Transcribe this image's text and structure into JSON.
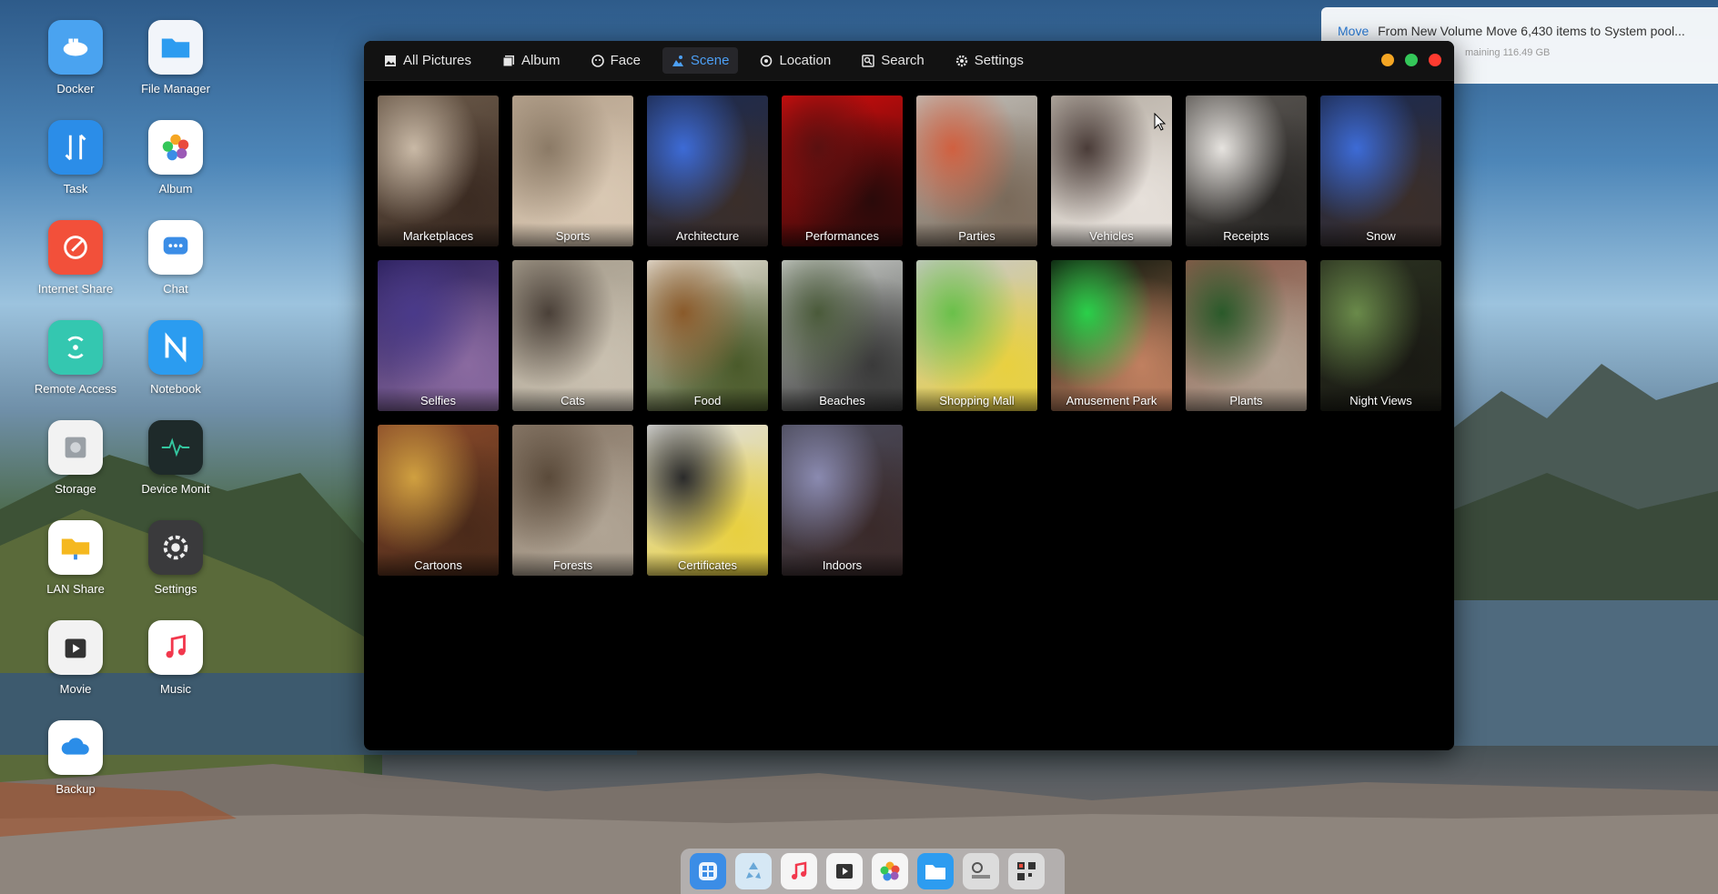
{
  "desktop_icons": [
    {
      "label": "Docker",
      "icon": "docker-icon"
    },
    {
      "label": "File Manager",
      "icon": "folder-icon"
    },
    {
      "label": "Task",
      "icon": "task-icon"
    },
    {
      "label": "Album",
      "icon": "album-icon"
    },
    {
      "label": "Internet Share",
      "icon": "share-icon"
    },
    {
      "label": "Chat",
      "icon": "chat-icon"
    },
    {
      "label": "Remote Access",
      "icon": "remote-access-icon"
    },
    {
      "label": "Notebook",
      "icon": "notebook-icon"
    },
    {
      "label": "Storage",
      "icon": "storage-icon"
    },
    {
      "label": "Device Monit",
      "icon": "device-monitor-icon"
    },
    {
      "label": "LAN Share",
      "icon": "lan-share-icon"
    },
    {
      "label": "Settings",
      "icon": "gear-icon"
    },
    {
      "label": "Movie",
      "icon": "movie-icon"
    },
    {
      "label": "Music",
      "icon": "music-icon"
    },
    {
      "label": "Backup",
      "icon": "backup-icon"
    }
  ],
  "notification": {
    "action": "Move",
    "text": "From New Volume Move 6,430 items to System pool...",
    "sub": "maining 116.49 GB"
  },
  "toolbar": {
    "tabs": [
      {
        "label": "All Pictures",
        "icon": "image-icon"
      },
      {
        "label": "Album",
        "icon": "album-icon"
      },
      {
        "label": "Face",
        "icon": "face-icon"
      },
      {
        "label": "Scene",
        "icon": "scene-icon",
        "active": true
      },
      {
        "label": "Location",
        "icon": "location-icon"
      },
      {
        "label": "Search",
        "icon": "search-icon"
      },
      {
        "label": "Settings",
        "icon": "gear-icon"
      }
    ]
  },
  "window_controls": {
    "minimize": "#f5a623",
    "maximize": "#34c759",
    "close": "#ff3b30"
  },
  "scenes": [
    {
      "label": "Marketplaces",
      "colors": [
        "#6b5a4a",
        "#c9b9a6",
        "#3b2b22"
      ]
    },
    {
      "label": "Sports",
      "colors": [
        "#b7a48f",
        "#8b7a66",
        "#d9c8b3"
      ]
    },
    {
      "label": "Architecture",
      "colors": [
        "#1c2a4f",
        "#3d6bd6",
        "#3a2e2a"
      ]
    },
    {
      "label": "Performances",
      "colors": [
        "#d40d0d",
        "#5a1010",
        "#2a0a0a"
      ]
    },
    {
      "label": "Parties",
      "colors": [
        "#c1beb8",
        "#d06040",
        "#7a6a5a"
      ]
    },
    {
      "label": "Vehicles",
      "colors": [
        "#b8b0a6",
        "#4a3c38",
        "#e6e0da"
      ]
    },
    {
      "label": "Receipts",
      "colors": [
        "#5a5652",
        "#e6e3df",
        "#2a2826"
      ]
    },
    {
      "label": "Snow",
      "colors": [
        "#1c2a4f",
        "#3d6bd6",
        "#3a2e2a"
      ]
    },
    {
      "label": "Selfies",
      "colors": [
        "#2a1f5a",
        "#4a3a8a",
        "#8a6aa0"
      ]
    },
    {
      "label": "Cats",
      "colors": [
        "#a79e8e",
        "#4a4038",
        "#c9c0b0"
      ]
    },
    {
      "label": "Food",
      "colors": [
        "#e8e2d8",
        "#8a5a2a",
        "#4a5a2a"
      ]
    },
    {
      "label": "Beaches",
      "colors": [
        "#c9ccc8",
        "#4a5a3a",
        "#3a3a3a"
      ]
    },
    {
      "label": "Shopping Mall",
      "colors": [
        "#c9c9c9",
        "#6ac04a",
        "#e8d040"
      ]
    },
    {
      "label": "Amusement Park",
      "colors": [
        "#0a140a",
        "#2ad04a",
        "#c08060"
      ]
    },
    {
      "label": "Plants",
      "colors": [
        "#8a5a4a",
        "#2a5a2a",
        "#b0a090"
      ]
    },
    {
      "label": "Night Views",
      "colors": [
        "#2a3020",
        "#6a8a4a",
        "#1a1a14"
      ]
    },
    {
      "label": "Cartoons",
      "colors": [
        "#8a4a2a",
        "#d0a040",
        "#4a2a1a"
      ]
    },
    {
      "label": "Forests",
      "colors": [
        "#8a7a6a",
        "#5a4a3a",
        "#b0a494"
      ]
    },
    {
      "label": "Certificates",
      "colors": [
        "#e0e0e0",
        "#2a2a2a",
        "#e8d040"
      ]
    },
    {
      "label": "Indoors",
      "colors": [
        "#4a4a5a",
        "#8a8ab0",
        "#3a2a2a"
      ]
    }
  ],
  "dock": [
    {
      "icon": "finder-icon",
      "color": "#3b8de6"
    },
    {
      "icon": "recycle-icon",
      "color": "#d6e8f5"
    },
    {
      "icon": "music-icon",
      "color": "#f5f5f5"
    },
    {
      "icon": "movie-icon",
      "color": "#f5f5f5"
    },
    {
      "icon": "album-icon",
      "color": "#f5f5f5"
    },
    {
      "icon": "folder-icon",
      "color": "#2d9cf0"
    },
    {
      "icon": "widget-icon",
      "color": "#dcdcdc"
    },
    {
      "icon": "qr-icon",
      "color": "#dcdcdc"
    }
  ]
}
